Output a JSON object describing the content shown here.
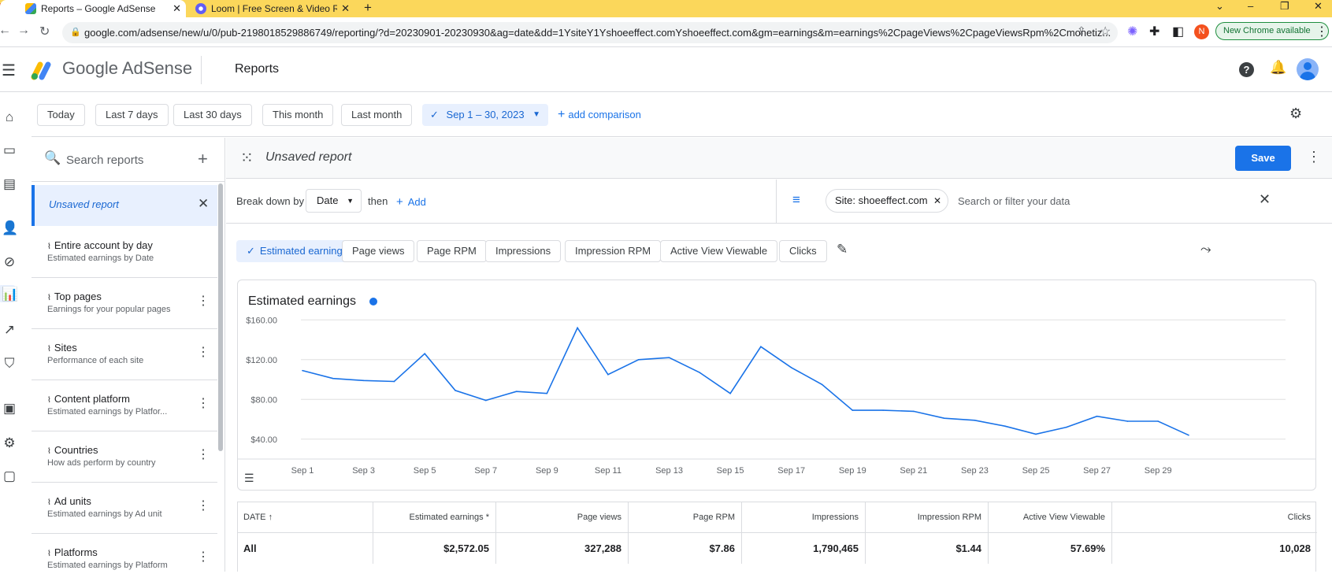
{
  "browser": {
    "tabs": [
      {
        "title": "Reports – Google AdSense",
        "icon": "adsense-logo-icon"
      },
      {
        "title": "Loom | Free Screen & Video Rec",
        "icon": "loom-logo-icon"
      }
    ],
    "new_tab": "+",
    "url": "google.com/adsense/new/u/0/pub-2198018529886749/reporting/?d=20230901-20230930&ag=date&dd=1YsiteY1Yshoeeffect.comYshoeeffect.com&gm=earnings&m=earnings%2CpageViews%2CpageViewsRpm%2Cmonetiz...",
    "new_chrome": "New Chrome available",
    "profile_initial": "N"
  },
  "app": {
    "brand": "Google AdSense",
    "title": "Reports"
  },
  "date_bar": {
    "presets": [
      "Today",
      "Last 7 days",
      "Last 30 days",
      "This month",
      "Last month"
    ],
    "selected_range": "Sep 1 – 30, 2023",
    "add_comparison": "add comparison"
  },
  "sidebar": {
    "search_placeholder": "Search reports",
    "unsaved_label": "Unsaved report",
    "items": [
      {
        "title": "Entire account by day",
        "subtitle": "Estimated earnings by Date"
      },
      {
        "title": "Top pages",
        "subtitle": "Earnings for your popular pages"
      },
      {
        "title": "Sites",
        "subtitle": "Performance of each site"
      },
      {
        "title": "Content platform",
        "subtitle": "Estimated earnings by Platfor..."
      },
      {
        "title": "Countries",
        "subtitle": "How ads perform by country"
      },
      {
        "title": "Ad units",
        "subtitle": "Estimated earnings by Ad unit"
      },
      {
        "title": "Platforms",
        "subtitle": "Estimated earnings by Platform"
      }
    ]
  },
  "report": {
    "title": "Unsaved report",
    "save_label": "Save",
    "breakdown_label": "Break down by",
    "breakdown_value": "Date",
    "then_label": "then",
    "add_label": "Add",
    "filter_chip": "Site: shoeeffect.com",
    "filter_placeholder": "Search or filter your data"
  },
  "metrics": [
    "Estimated earnings",
    "Page views",
    "Page RPM",
    "Impressions",
    "Impression RPM",
    "Active View Viewable",
    "Clicks"
  ],
  "chart_data": {
    "type": "line",
    "title": "Estimated earnings",
    "x": [
      "Sep 1",
      "Sep 2",
      "Sep 3",
      "Sep 4",
      "Sep 5",
      "Sep 6",
      "Sep 7",
      "Sep 8",
      "Sep 9",
      "Sep 10",
      "Sep 11",
      "Sep 12",
      "Sep 13",
      "Sep 14",
      "Sep 15",
      "Sep 16",
      "Sep 17",
      "Sep 18",
      "Sep 19",
      "Sep 20",
      "Sep 21",
      "Sep 22",
      "Sep 23",
      "Sep 24",
      "Sep 25",
      "Sep 26",
      "Sep 27",
      "Sep 28",
      "Sep 29",
      "Sep 30"
    ],
    "x_tick_labels": [
      "Sep 1",
      "Sep 3",
      "Sep 5",
      "Sep 7",
      "Sep 9",
      "Sep 11",
      "Sep 13",
      "Sep 15",
      "Sep 17",
      "Sep 19",
      "Sep 21",
      "Sep 23",
      "Sep 25",
      "Sep 27",
      "Sep 29"
    ],
    "series": [
      {
        "name": "Estimated earnings",
        "color": "#1a73e8",
        "values": [
          109,
          101,
          99,
          98,
          126,
          89,
          79,
          88,
          86,
          152,
          105,
          120,
          122,
          107,
          86,
          133,
          112,
          95,
          69,
          69,
          68,
          61,
          59,
          53,
          45,
          52,
          63,
          58,
          58,
          44
        ]
      }
    ],
    "y_ticks": [
      "$40.00",
      "$80.00",
      "$120.00",
      "$160.00"
    ],
    "ylim": [
      20,
      180
    ],
    "grid": true
  },
  "table": {
    "headers": [
      "DATE",
      "Estimated earnings *",
      "Page views",
      "Page RPM",
      "Impressions",
      "Impression RPM",
      "Active View Viewable",
      "Clicks"
    ],
    "total_row": [
      "All",
      "$2,572.05",
      "327,288",
      "$7.86",
      "1,790,465",
      "$1.44",
      "57.69%",
      "10,028"
    ]
  },
  "colors": {
    "accent": "#1a73e8",
    "tabbar": "#fbd75b"
  }
}
